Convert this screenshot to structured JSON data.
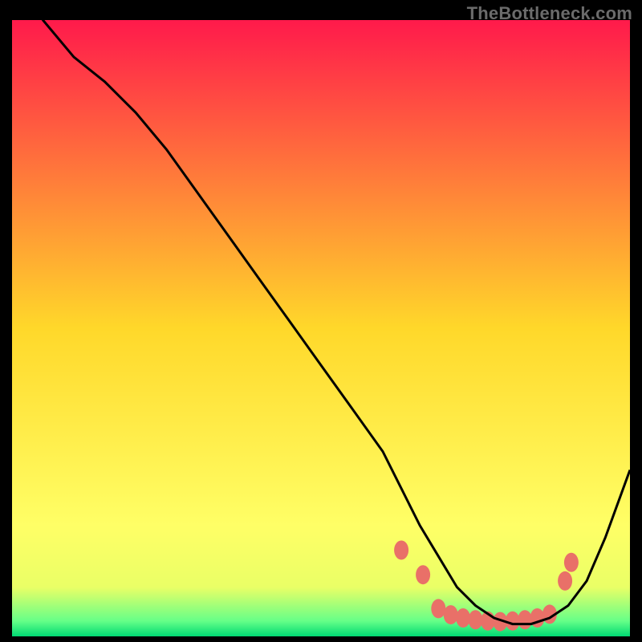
{
  "watermark": "TheBottleneck.com",
  "chart_data": {
    "type": "line",
    "title": "",
    "xlabel": "",
    "ylabel": "",
    "xlim": [
      0,
      100
    ],
    "ylim": [
      0,
      100
    ],
    "background_gradient": {
      "stops": [
        {
          "offset": 0.0,
          "color": "#ff1a4b"
        },
        {
          "offset": 0.5,
          "color": "#ffd82a"
        },
        {
          "offset": 0.82,
          "color": "#ffff66"
        },
        {
          "offset": 0.92,
          "color": "#eaff66"
        },
        {
          "offset": 0.975,
          "color": "#66ff88"
        },
        {
          "offset": 1.0,
          "color": "#00d973"
        }
      ]
    },
    "series": [
      {
        "name": "bottleneck-curve",
        "color": "#000000",
        "x": [
          0,
          5,
          10,
          15,
          20,
          25,
          30,
          35,
          40,
          45,
          50,
          55,
          60,
          63,
          66,
          69,
          72,
          75,
          78,
          81,
          84,
          87,
          90,
          93,
          96,
          100
        ],
        "y": [
          110,
          100,
          94,
          90,
          85,
          79,
          72,
          65,
          58,
          51,
          44,
          37,
          30,
          24,
          18,
          13,
          8,
          5,
          3,
          2,
          2,
          3,
          5,
          9,
          16,
          27
        ]
      }
    ],
    "markers": {
      "name": "recommended-range",
      "color": "#e97068",
      "x": [
        63.0,
        66.5,
        69.0,
        71.0,
        73.0,
        75.0,
        77.0,
        79.0,
        81.0,
        83.0,
        85.0,
        87.0,
        89.5,
        90.5
      ],
      "y": [
        14.0,
        10.0,
        4.5,
        3.5,
        3.0,
        2.7,
        2.5,
        2.4,
        2.5,
        2.7,
        3.0,
        3.6,
        9.0,
        12.0
      ]
    }
  }
}
